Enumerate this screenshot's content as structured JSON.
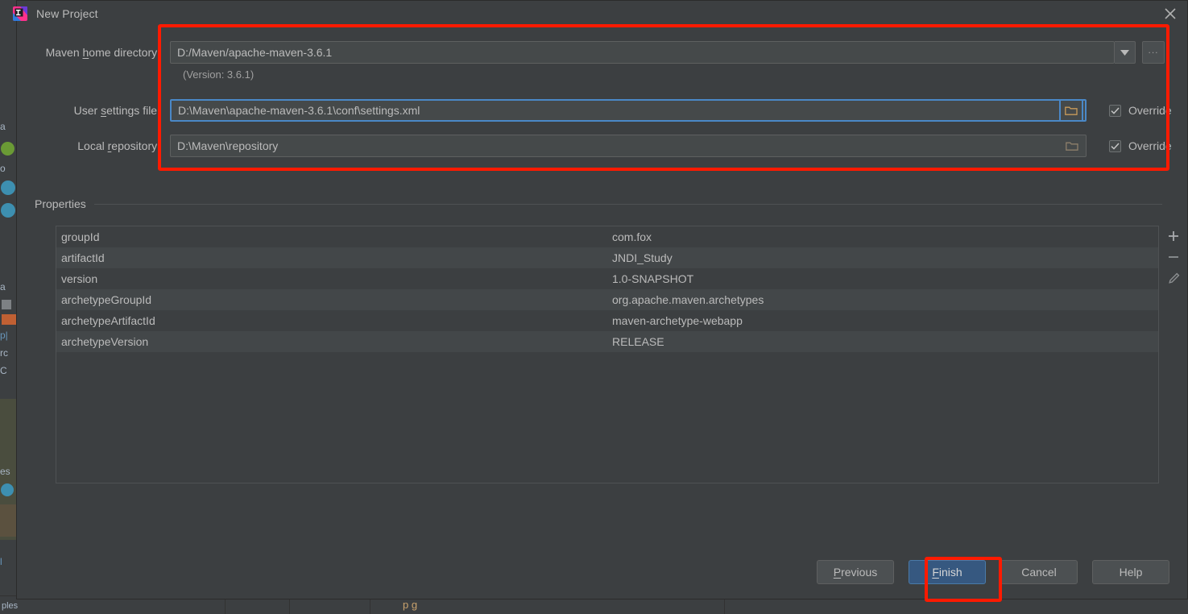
{
  "window": {
    "title": "New Project",
    "app_icon": "intellij-idea-icon",
    "close_icon": "close-icon"
  },
  "form": {
    "maven_home": {
      "label_before": "Maven ",
      "label_mnemonic": "h",
      "label_after": "ome directory:",
      "value": "D:/Maven/apache-maven-3.6.1",
      "dropdown_icon": "chevron-down-icon",
      "browse_label": "...",
      "version_note": "(Version: 3.6.1)"
    },
    "user_settings": {
      "label_before": "User ",
      "label_mnemonic": "s",
      "label_after": "ettings file:",
      "value": "D:\\Maven\\apache-maven-3.6.1\\conf\\settings.xml",
      "folder_icon": "folder-icon",
      "override_label": "Override",
      "override_checked": true
    },
    "local_repository": {
      "label_before": "Local ",
      "label_mnemonic": "r",
      "label_after": "epository:",
      "value": "D:\\Maven\\repository",
      "folder_icon": "folder-icon",
      "override_label": "Override",
      "override_checked": true
    }
  },
  "properties": {
    "section_title": "Properties",
    "rows": [
      {
        "key": "groupId",
        "value": "com.fox"
      },
      {
        "key": "artifactId",
        "value": "JNDI_Study"
      },
      {
        "key": "version",
        "value": "1.0-SNAPSHOT"
      },
      {
        "key": "archetypeGroupId",
        "value": "org.apache.maven.archetypes"
      },
      {
        "key": "archetypeArtifactId",
        "value": "maven-archetype-webapp"
      },
      {
        "key": "archetypeVersion",
        "value": "RELEASE"
      }
    ],
    "toolbar": {
      "add_icon": "plus-icon",
      "remove_icon": "minus-icon",
      "edit_icon": "pencil-icon"
    }
  },
  "footer": {
    "previous": {
      "before": "",
      "mnemonic": "P",
      "after": "revious"
    },
    "finish": {
      "before": "",
      "mnemonic": "F",
      "after": "inish"
    },
    "cancel": {
      "label": "Cancel"
    },
    "help": {
      "label": "Help"
    }
  },
  "background": {
    "left_fragments": [
      "a",
      "o",
      "a",
      "p|",
      "rc",
      "C",
      "es",
      "l"
    ],
    "bottom_text": "ples",
    "right_icons": [
      "firefox-icon",
      "csdn-icon"
    ]
  },
  "colors": {
    "dialog_bg": "#3c3f41",
    "field_bg": "#45494a",
    "text": "#bbbbbb",
    "focus_border": "#4a88c7",
    "primary_button": "#365880",
    "annotation_red": "#ff1a00",
    "row_alt": "#434749"
  }
}
